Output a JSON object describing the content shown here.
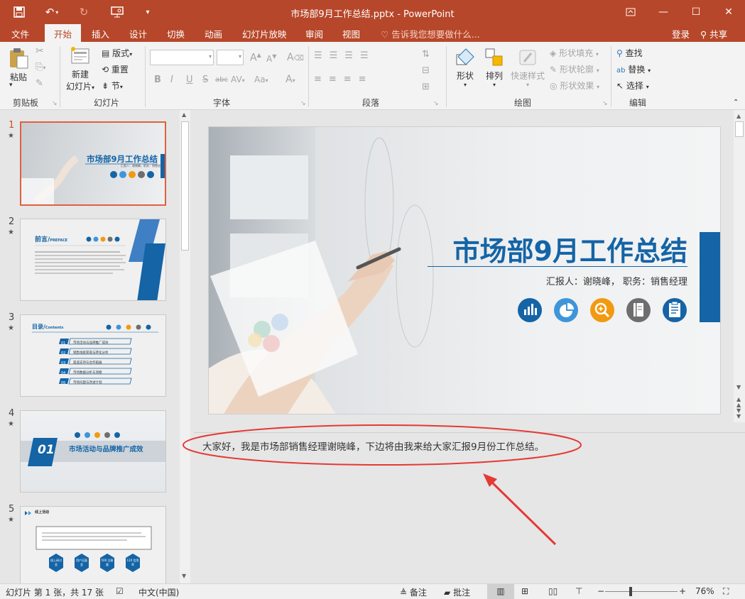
{
  "window": {
    "title": "市场部9月工作总结.pptx - PowerPoint"
  },
  "tabs": {
    "file": "文件",
    "home": "开始",
    "insert": "插入",
    "design": "设计",
    "transitions": "切换",
    "animations": "动画",
    "slideshow": "幻灯片放映",
    "review": "审阅",
    "view": "视图",
    "tellme": "告诉我您想要做什么...",
    "signin": "登录",
    "share": "共享"
  },
  "ribbon": {
    "clipboard": {
      "paste": "粘贴",
      "label": "剪贴板"
    },
    "slides": {
      "new_slide": "新建",
      "new_slide2": "幻灯片",
      "layout": "版式",
      "reset": "重置",
      "section": "节",
      "label": "幻灯片"
    },
    "font": {
      "label": "字体",
      "bold": "B",
      "italic": "I",
      "underline": "U",
      "shadow": "S",
      "strike": "abc",
      "spacing": "AV",
      "case": "Aa",
      "color": "A",
      "grow": "A",
      "shrink": "A",
      "clear": "A"
    },
    "paragraph": {
      "label": "段落"
    },
    "drawing": {
      "shapes": "形状",
      "arrange": "排列",
      "quick_styles": "快速样式",
      "fill": "形状填充",
      "outline": "形状轮廓",
      "effects": "形状效果",
      "label": "绘图"
    },
    "editing": {
      "find": "查找",
      "replace": "替换",
      "select": "选择",
      "label": "编辑"
    }
  },
  "thumbnails": [
    {
      "num": "1",
      "title": "市场部9月工作总结",
      "sub": "汇报人：谢晓峰，职务：销售经理"
    },
    {
      "num": "2",
      "title": "前言/",
      "title_en": "PREFACE"
    },
    {
      "num": "3",
      "title": "目录/",
      "title_en": "Contents",
      "items": [
        "01",
        "02",
        "03",
        "04",
        "05"
      ],
      "item_texts": [
        "市场活动与品牌推广成效",
        "销售线索获取与转化分析",
        "渠道支持与合作拓展",
        "市场数据分析与洞察",
        "市场问题与改进计划"
      ]
    },
    {
      "num": "4",
      "title": "市场活动与品牌推广成效",
      "big": "01"
    },
    {
      "num": "5",
      "title": "线上活动",
      "hex": [
        "线上研讨会",
        "用户见面会",
        "500 注册量",
        "120 信用率"
      ]
    }
  ],
  "slide": {
    "title": "市场部9月工作总结",
    "subtitle": "汇报人：谢晓峰，  职务：销售经理",
    "icons": [
      "chart-bar-icon",
      "pie-chart-icon",
      "zoom-icon",
      "notebook-icon",
      "document-icon"
    ],
    "icon_colors": [
      "#1464a6",
      "#3f95d9",
      "#f19a11",
      "#6e6e6e",
      "#1464a6"
    ]
  },
  "notes": {
    "text": "大家好，我是市场部销售经理谢晓峰，下边将由我来给大家汇报9月份工作总结。"
  },
  "status": {
    "slide_info": "幻灯片 第 1 张，共 17 张",
    "language": "中文(中国)",
    "notes": "备注",
    "comments": "批注",
    "zoom": "76%"
  },
  "colors": {
    "accent": "#b7472a",
    "brand_blue": "#1464a6",
    "annotation": "#e53935"
  }
}
